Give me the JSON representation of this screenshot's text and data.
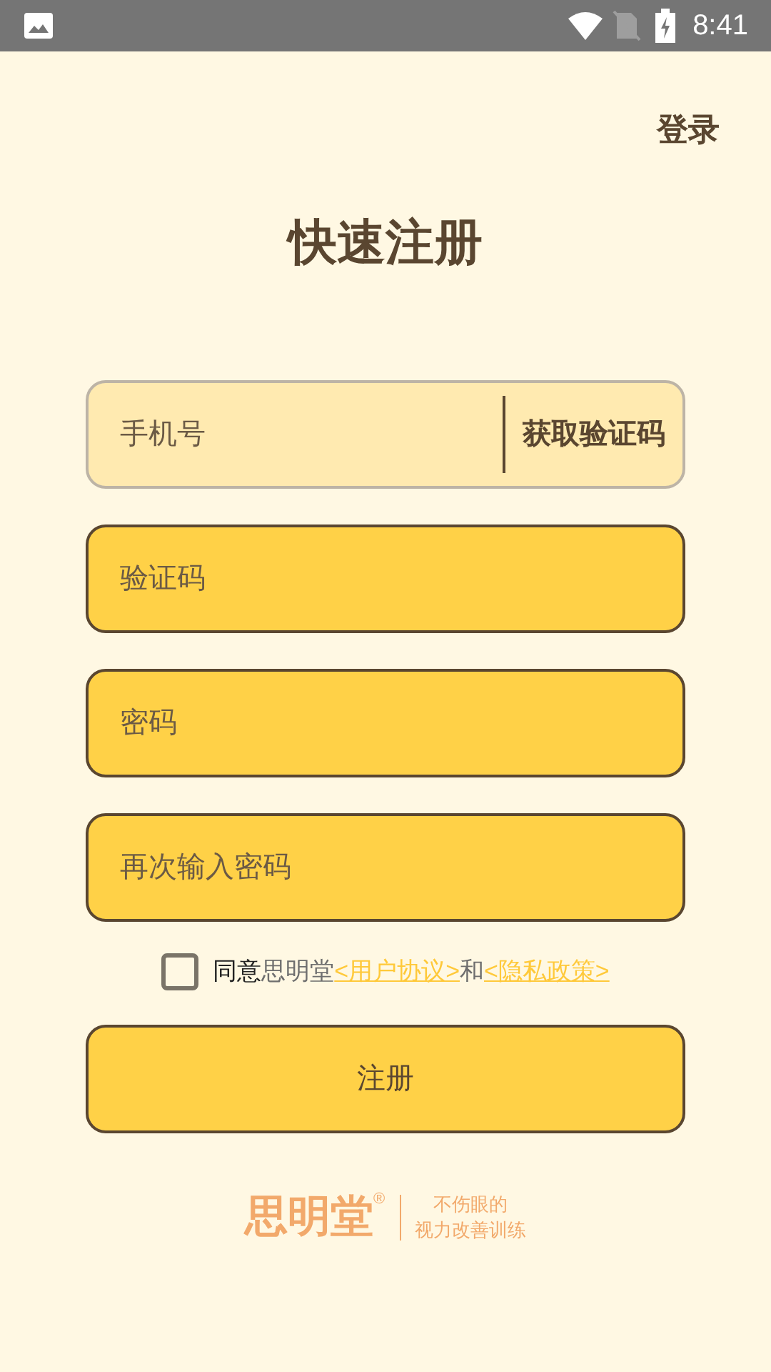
{
  "status_bar": {
    "time": "8:41"
  },
  "header": {
    "login_link": "登录",
    "title": "快速注册"
  },
  "fields": [
    {
      "kind": "phone",
      "placeholder": "手机号",
      "focused": true,
      "action": "获取验证码"
    },
    {
      "kind": "text",
      "placeholder": "验证码",
      "focused": false
    },
    {
      "kind": "password",
      "placeholder": "密码",
      "focused": false
    },
    {
      "kind": "password",
      "placeholder": "再次输入密码",
      "focused": false
    }
  ],
  "agreement": {
    "checked": false,
    "parts": [
      {
        "kind": "plain",
        "text": "同意"
      },
      {
        "kind": "brand",
        "text": "思明堂"
      },
      {
        "kind": "link",
        "text": "<用户协议>"
      },
      {
        "kind": "brand",
        "text": "和"
      },
      {
        "kind": "link",
        "text": "<隐私政策>"
      }
    ]
  },
  "submit_button": "注册",
  "logo": {
    "name": "思明堂",
    "mark": "®",
    "slogan_1": "不伤眼的",
    "slogan_2": "视力改善训练"
  }
}
